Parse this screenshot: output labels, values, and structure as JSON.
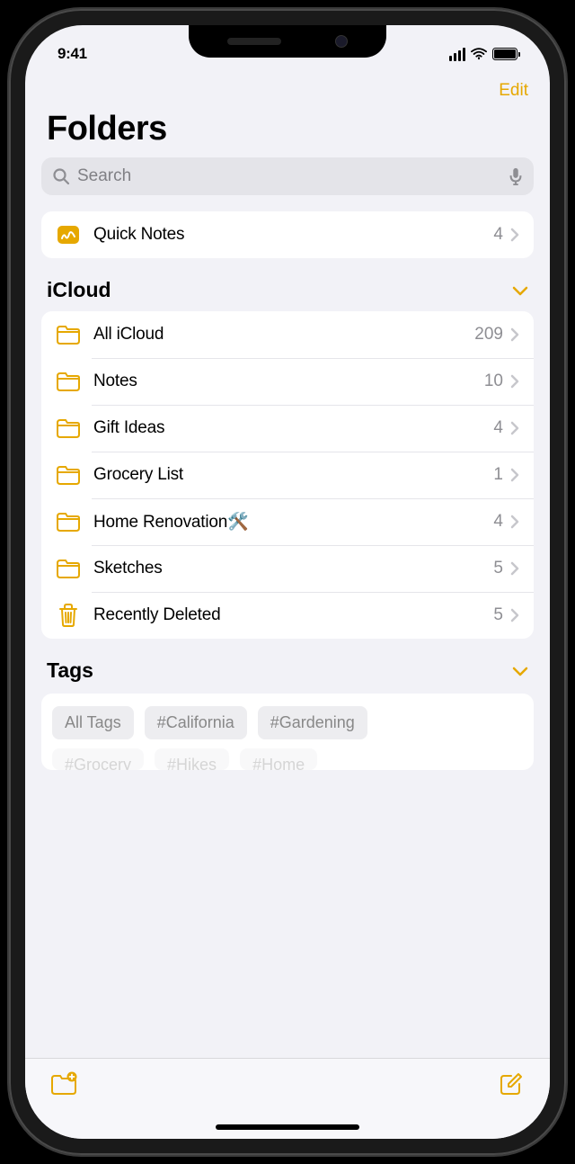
{
  "status": {
    "time": "9:41"
  },
  "nav": {
    "edit": "Edit"
  },
  "title": "Folders",
  "search": {
    "placeholder": "Search"
  },
  "quick_notes": {
    "label": "Quick Notes",
    "count": "4"
  },
  "sections": {
    "icloud": {
      "title": "iCloud",
      "items": [
        {
          "label": "All iCloud",
          "count": "209",
          "icon": "folder"
        },
        {
          "label": "Notes",
          "count": "10",
          "icon": "folder"
        },
        {
          "label": "Gift Ideas",
          "count": "4",
          "icon": "folder"
        },
        {
          "label": "Grocery List",
          "count": "1",
          "icon": "folder"
        },
        {
          "label": "Home Renovation🛠️",
          "count": "4",
          "icon": "folder"
        },
        {
          "label": "Sketches",
          "count": "5",
          "icon": "folder"
        },
        {
          "label": "Recently Deleted",
          "count": "5",
          "icon": "trash"
        }
      ]
    },
    "tags": {
      "title": "Tags",
      "items": [
        "All Tags",
        "#California",
        "#Gardening",
        "#Grocery",
        "#Hikes",
        "#Home"
      ]
    }
  }
}
